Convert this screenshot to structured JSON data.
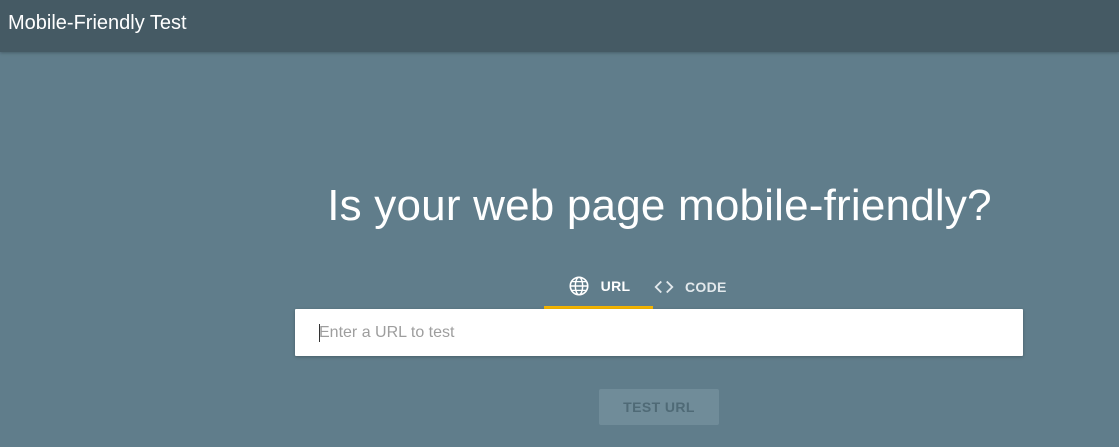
{
  "header": {
    "title": "Mobile-Friendly Test"
  },
  "main": {
    "headline": "Is your web page mobile-friendly?",
    "tabs": [
      {
        "label": "URL",
        "icon": "globe-icon",
        "active": true
      },
      {
        "label": "CODE",
        "icon": "code-brackets-icon",
        "active": false
      }
    ],
    "url_input": {
      "value": "",
      "placeholder": "Enter a URL to test"
    },
    "submit_button": {
      "label": "TEST URL",
      "enabled": false
    }
  },
  "colors": {
    "background": "#607d8b",
    "topbar": "#455a64",
    "active_tab_indicator": "#f4b400",
    "button_disabled": "#708c99"
  }
}
